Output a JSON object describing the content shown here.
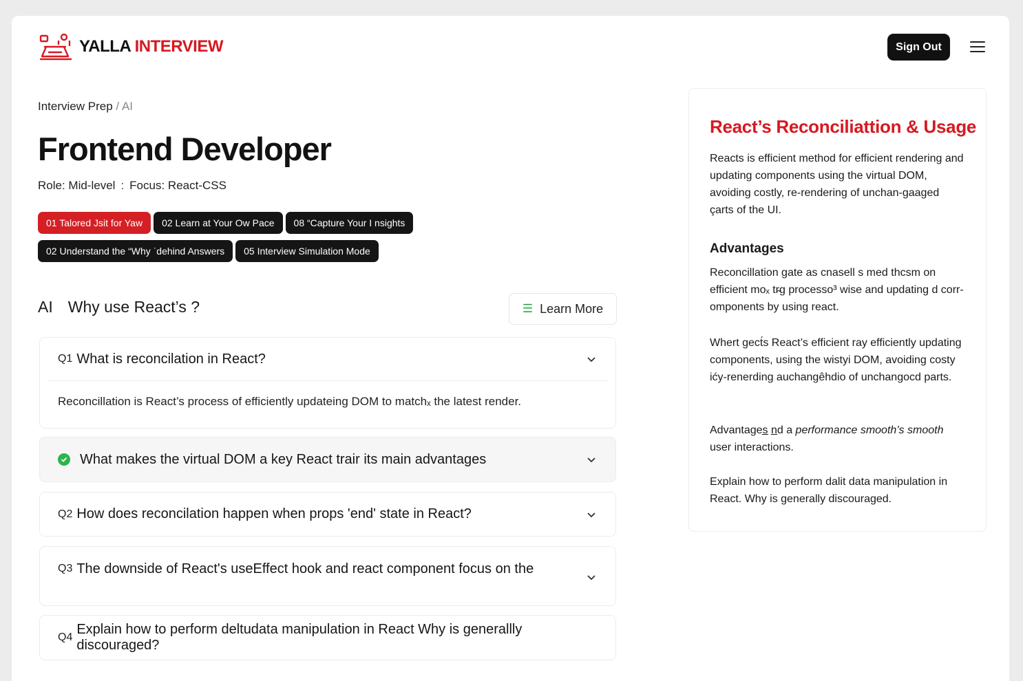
{
  "brand": {
    "name_part1": "YALLA",
    "name_part2": "INTERVIEW",
    "accent": "#d71920"
  },
  "header": {
    "signout_label": "Sign Out",
    "menu_icon": "hamburger-menu-icon"
  },
  "breadcrumb": {
    "parent": "Interview Prep",
    "separator": "/",
    "current": "AI"
  },
  "page": {
    "title": "Frontend Developer",
    "role": "Role: Mid-level",
    "dot": ":",
    "focus": "Focus: React-CSS"
  },
  "pills": [
    {
      "label": "01 Talored Jsit for Yaw",
      "active": true
    },
    {
      "label": "02 Learn at Your Ow Pace",
      "active": false
    },
    {
      "label": "08 “Capture Your I nsights",
      "active": false
    },
    {
      "label": "02 Understand the “Why ˈdehind Answers",
      "active": false
    },
    {
      "label": "05 Interview Simulation Mode",
      "active": false
    }
  ],
  "section": {
    "prefix": "AI",
    "title": "Why use React’s ?",
    "learn_more": "Learn More"
  },
  "questions": [
    {
      "num": "Q1",
      "text": "What is reconcilation in React?",
      "answer": "Reconcillation is React’s process of efficiently updateing DOM to matchₓ the latest render.",
      "expanded": true
    },
    {
      "num": "",
      "text": "What makes the virtual DOM a key React trair its main advantages",
      "checked": true
    },
    {
      "num": "Q2",
      "text": "How does reconcilation happen when props 'end' state in React?"
    },
    {
      "num": "Q3",
      "text": "The downside of React's useEffect hook and react component focus on the"
    },
    {
      "num": "Q4",
      "text": "Explain how to perform deltudata manipulation in React Why is generallly discouraged?"
    }
  ],
  "card": {
    "title": "React’s Reconciliattion & Usage",
    "p1": "Reacts is efficient method for efficient rendering and updating components using the virtual DOM, avoiding costly, re-rendering of unchan-gaaged çarts of the UI.",
    "advantages_heading": "Advantages",
    "p2": "Reconcillation gate as cnasell s med thcsm on efficient moₓ tr̴g processo³ wise and updating d corr-omponents by using react.",
    "p3": "Whert gect́s React’s efficient ray efficiently updating components, using the wistyi DOM, avoiding costy ićy-renerding auchangêhdio of unchangocd parts.",
    "p4_plain": "Advantages̲ n̲d a ",
    "p4_italic": "performance smooth’s smooth",
    "p4_end": "user interactions.",
    "p5": "Explain how to perform dalit data manipulation in React. Why is generally discouraged."
  },
  "colors": {
    "pill_dark": "#151515",
    "pill_red": "#d42024",
    "check_green": "#2db44b"
  }
}
